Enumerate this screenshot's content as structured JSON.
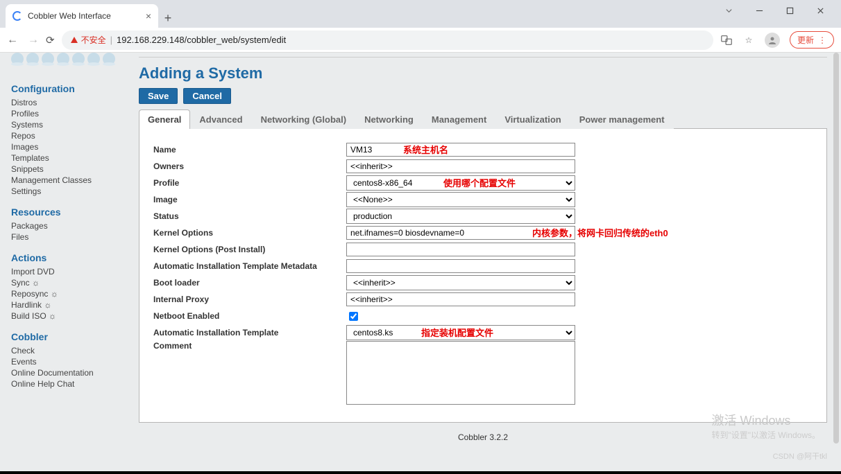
{
  "browser": {
    "tab_title": "Cobbler Web Interface",
    "insecure_label": "不安全",
    "url": "192.168.229.148/cobbler_web/system/edit",
    "update_label": "更新"
  },
  "sidebar": {
    "sections": [
      {
        "title": "Configuration",
        "items": [
          "Distros",
          "Profiles",
          "Systems",
          "Repos",
          "Images",
          "Templates",
          "Snippets",
          "Management Classes",
          "Settings"
        ]
      },
      {
        "title": "Resources",
        "items": [
          "Packages",
          "Files"
        ]
      },
      {
        "title": "Actions",
        "items": [
          "Import DVD",
          "Sync ☼",
          "Reposync ☼",
          "Hardlink ☼",
          "Build ISO ☼"
        ]
      },
      {
        "title": "Cobbler",
        "items": [
          "Check",
          "Events",
          "Online Documentation",
          "Online Help Chat"
        ]
      }
    ]
  },
  "page": {
    "title": "Adding a System",
    "save": "Save",
    "cancel": "Cancel",
    "tabs": [
      "General",
      "Advanced",
      "Networking (Global)",
      "Networking",
      "Management",
      "Virtualization",
      "Power management"
    ],
    "active_tab": 0
  },
  "form": {
    "name": {
      "label": "Name",
      "value": "VM13"
    },
    "owners": {
      "label": "Owners",
      "value": "<<inherit>>"
    },
    "profile": {
      "label": "Profile",
      "value": "centos8-x86_64"
    },
    "image": {
      "label": "Image",
      "value": "<<None>>"
    },
    "status": {
      "label": "Status",
      "value": "production"
    },
    "kernel_options": {
      "label": "Kernel Options",
      "value": "net.ifnames=0 biosdevname=0"
    },
    "kernel_options_post": {
      "label": "Kernel Options (Post Install)",
      "value": ""
    },
    "autoinstall_meta": {
      "label": "Automatic Installation Template Metadata",
      "value": ""
    },
    "boot_loader": {
      "label": "Boot loader",
      "value": "<<inherit>>"
    },
    "internal_proxy": {
      "label": "Internal Proxy",
      "value": "<<inherit>>"
    },
    "netboot_enabled": {
      "label": "Netboot Enabled",
      "checked": true
    },
    "autoinstall_template": {
      "label": "Automatic Installation Template",
      "value": "centos8.ks"
    },
    "comment": {
      "label": "Comment",
      "value": ""
    }
  },
  "annotations": {
    "name": "系统主机名",
    "profile": "使用哪个配置文件",
    "kernel": "内核参数，将网卡回归传统的eth0",
    "template": "指定装机配置文件"
  },
  "footer": "Cobbler 3.2.2",
  "watermark": {
    "line1": "激活 Windows",
    "line2": "转到\"设置\"以激活 Windows。"
  },
  "csdn": "CSDN @阿干tkl"
}
